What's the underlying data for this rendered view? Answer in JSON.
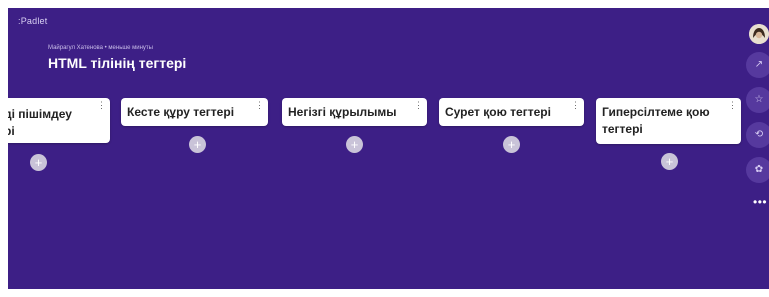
{
  "header": {
    "logo": ":Padlet",
    "meta": "Майрагул Хатенова • меньше минуты",
    "title": "HTML тілінің тегтері"
  },
  "columns": [
    {
      "label": "ді пішімдеу\nрі"
    },
    {
      "label": "Кесте құру тегтері"
    },
    {
      "label": "Негізгі құрылымы"
    },
    {
      "label": "Сурет қою тегтері"
    },
    {
      "label": "Гиперсілтеме қою тегтері"
    }
  ],
  "ui": {
    "menu_glyph": "⋮",
    "add_glyph": "+",
    "more_glyph": "•••"
  },
  "rail": {
    "share_icon": "↗",
    "star_icon": "☆",
    "remake_icon": "⟲",
    "settings_icon": "✿"
  }
}
